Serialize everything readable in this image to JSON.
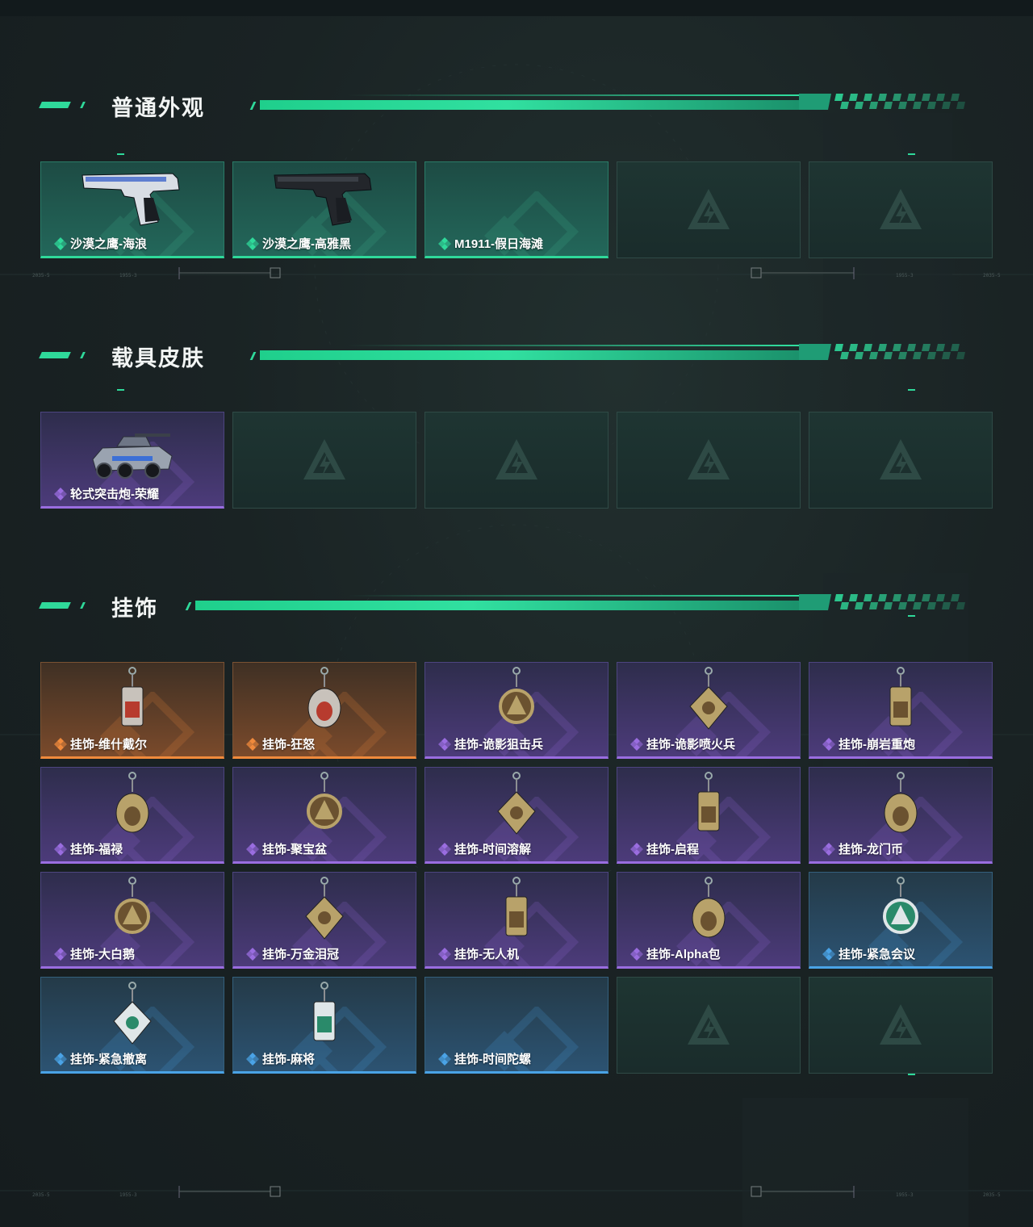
{
  "sections": [
    {
      "title": "普通外观",
      "items": [
        {
          "label": "沙漠之鹰-海浪",
          "rarity": "green",
          "icon": "pistol-blue-icon"
        },
        {
          "label": "沙漠之鹰-高雅黑",
          "rarity": "green",
          "icon": "pistol-black-icon"
        },
        {
          "label": "M1911-假日海滩",
          "rarity": "green",
          "icon": ""
        },
        {
          "label": "",
          "rarity": "empty",
          "icon": "placeholder-logo-icon"
        },
        {
          "label": "",
          "rarity": "empty",
          "icon": "placeholder-logo-icon"
        }
      ]
    },
    {
      "title": "载具皮肤",
      "items": [
        {
          "label": "轮式突击炮-荣耀",
          "rarity": "purple",
          "icon": "armored-vehicle-icon"
        },
        {
          "label": "",
          "rarity": "empty",
          "icon": "placeholder-logo-icon"
        },
        {
          "label": "",
          "rarity": "empty",
          "icon": "placeholder-logo-icon"
        },
        {
          "label": "",
          "rarity": "empty",
          "icon": "placeholder-logo-icon"
        },
        {
          "label": "",
          "rarity": "empty",
          "icon": "placeholder-logo-icon"
        }
      ]
    },
    {
      "title": "挂饰",
      "items": [
        {
          "label": "挂饰-维什戴尔",
          "rarity": "orange",
          "icon": "charm-icon"
        },
        {
          "label": "挂饰-狂怒",
          "rarity": "orange",
          "icon": "charm-icon"
        },
        {
          "label": "挂饰-诡影狙击兵",
          "rarity": "purple",
          "icon": "charm-icon"
        },
        {
          "label": "挂饰-诡影喷火兵",
          "rarity": "purple",
          "icon": "charm-icon"
        },
        {
          "label": "挂饰-崩岩重炮",
          "rarity": "purple",
          "icon": "charm-icon"
        },
        {
          "label": "挂饰-福禄",
          "rarity": "purple",
          "icon": "charm-icon"
        },
        {
          "label": "挂饰-聚宝盆",
          "rarity": "purple",
          "icon": "charm-icon"
        },
        {
          "label": "挂饰-时间溶解",
          "rarity": "purple",
          "icon": "charm-icon"
        },
        {
          "label": "挂饰-启程",
          "rarity": "purple",
          "icon": "charm-icon"
        },
        {
          "label": "挂饰-龙门币",
          "rarity": "purple",
          "icon": "charm-icon"
        },
        {
          "label": "挂饰-大白鹅",
          "rarity": "purple",
          "icon": "charm-icon"
        },
        {
          "label": "挂饰-万金泪冠",
          "rarity": "purple",
          "icon": "charm-icon"
        },
        {
          "label": "挂饰-无人机",
          "rarity": "purple",
          "icon": "charm-icon"
        },
        {
          "label": "挂饰-Alpha包",
          "rarity": "purple",
          "icon": "charm-icon"
        },
        {
          "label": "挂饰-紧急会议",
          "rarity": "blue",
          "icon": "charm-icon"
        },
        {
          "label": "挂饰-紧急撤离",
          "rarity": "blue",
          "icon": "charm-icon"
        },
        {
          "label": "挂饰-麻将",
          "rarity": "blue",
          "icon": "charm-icon"
        },
        {
          "label": "挂饰-时间陀螺",
          "rarity": "blue",
          "icon": ""
        },
        {
          "label": "",
          "rarity": "empty",
          "icon": "placeholder-logo-icon"
        },
        {
          "label": "",
          "rarity": "empty",
          "icon": "placeholder-logo-icon"
        }
      ]
    }
  ],
  "colors": {
    "accent": "#2fd99a",
    "green": "#2fd99a",
    "purple": "#9a6de0",
    "orange": "#f08a3c",
    "blue": "#4aa3e6",
    "background": "#1a2324"
  },
  "decor": {
    "tech_label_a": "2035-5",
    "tech_label_b": "1955-3"
  }
}
